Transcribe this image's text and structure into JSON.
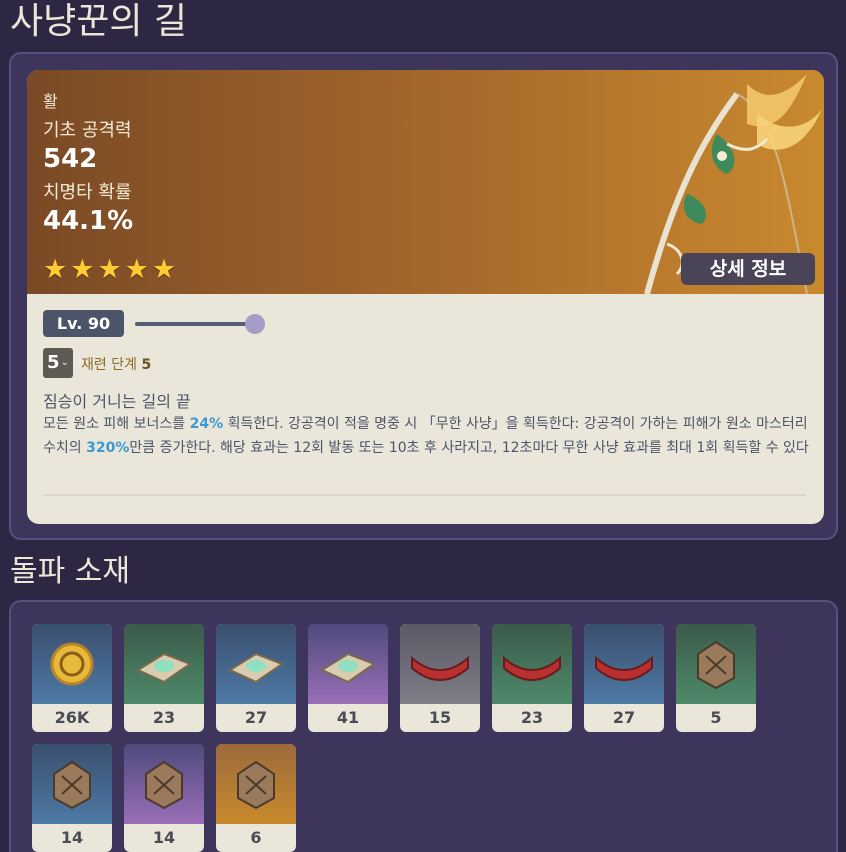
{
  "page": {
    "title": "사냥꾼의 길"
  },
  "weapon": {
    "type": "활",
    "base_atk_label": "기초 공격력",
    "base_atk_value": "542",
    "crit_label": "치명타 확률",
    "crit_value": "44.1%",
    "rarity": 5,
    "details_button": "상세 정보"
  },
  "level": {
    "label": "Lv. 90",
    "slider_fraction": 1.0
  },
  "refinement": {
    "selected": "5",
    "label": "재련 단계",
    "value": "5"
  },
  "passive": {
    "name": "짐승이 거니는 길의 끝",
    "desc_1": "모든 원소 피해 보너스를 ",
    "hl_1": "24%",
    "desc_2": " 획득한다. 강공격이 적을 명중 시 「무한 사냥」을 획득한다: 강공격이 가하는 피해가 원소 마스터리 수치의 ",
    "hl_2": "320%",
    "desc_3": "만큼 증가한다. 해당 효과는 12회 발동 또는 10초 후 사라지고, 12초마다 무한 사냥 효과를 최대 1회 획득할 수 있다"
  },
  "materials": {
    "title": "돌파 소재",
    "items": [
      {
        "icon": "mora-coin-icon",
        "count": "26K",
        "rarity": "r3"
      },
      {
        "icon": "tablet-green-icon",
        "count": "23",
        "rarity": "r2"
      },
      {
        "icon": "tablet-blue-icon",
        "count": "27",
        "rarity": "r3"
      },
      {
        "icon": "tablet-purple-icon",
        "count": "41",
        "rarity": "r4"
      },
      {
        "icon": "handguard-gray-icon",
        "count": "15",
        "rarity": "r1"
      },
      {
        "icon": "handguard-green-icon",
        "count": "23",
        "rarity": "r2"
      },
      {
        "icon": "handguard-blue-icon",
        "count": "27",
        "rarity": "r3"
      },
      {
        "icon": "chaos-gear-green-icon",
        "count": "5",
        "rarity": "r2"
      },
      {
        "icon": "chaos-gear-blue-icon",
        "count": "14",
        "rarity": "r3"
      },
      {
        "icon": "chaos-gear-purple-icon",
        "count": "14",
        "rarity": "r4"
      },
      {
        "icon": "chaos-gear-gold-icon",
        "count": "6",
        "rarity": "r5"
      }
    ]
  },
  "colors": {
    "background": "#2e2743",
    "panel": "#3e355c",
    "card_top": "#a86a2c",
    "star": "#ffcc32",
    "highlight": "#3a9ad5"
  }
}
